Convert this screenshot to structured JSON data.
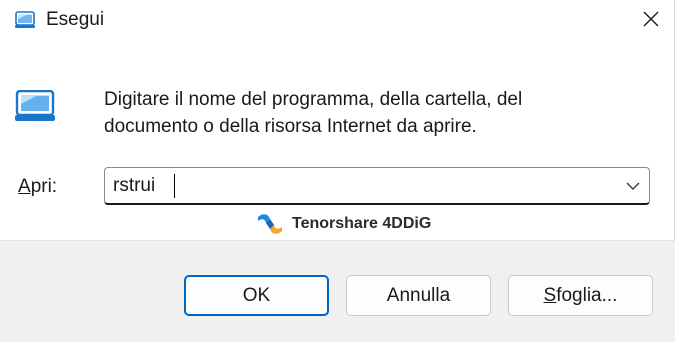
{
  "window": {
    "title": "Esegui",
    "close_icon": "close-icon",
    "app_icon": "run-dialog-icon"
  },
  "content": {
    "description": "Digitare il nome del programma, della cartella, del documento o della risorsa Internet da aprire.",
    "open_label_prefix": "A",
    "open_label_rest": "pri:",
    "input_value": "rstrui"
  },
  "watermark": {
    "text": "Tenorshare 4DDiG"
  },
  "buttons": {
    "ok": "OK",
    "cancel": "Annulla",
    "browse_prefix": "S",
    "browse_rest": "foglia..."
  },
  "colors": {
    "accent": "#0067c0",
    "footer_bg": "#f0f0f0"
  }
}
